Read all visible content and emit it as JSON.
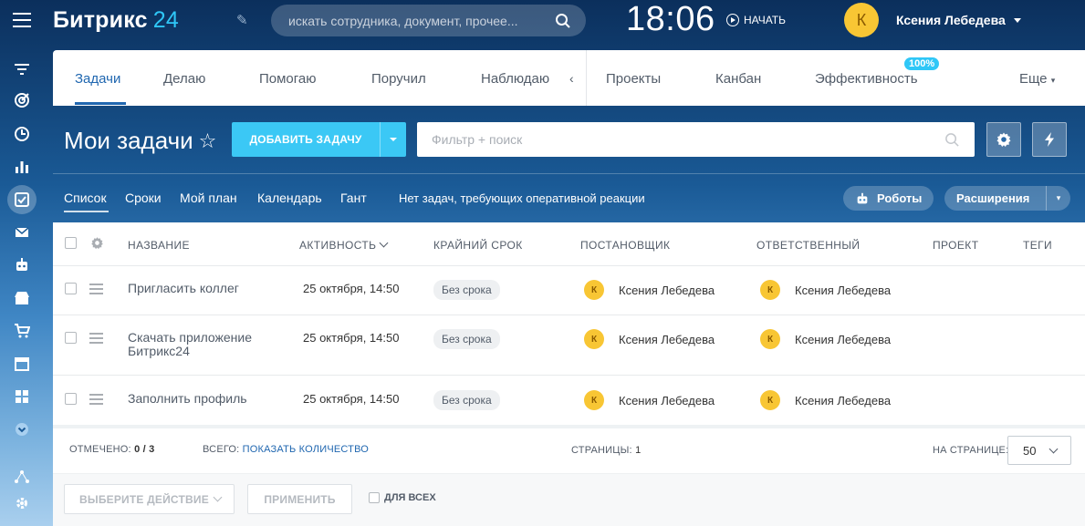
{
  "header": {
    "logo_text": "Битрикс",
    "logo_num": "24",
    "search_placeholder": "искать сотрудника, документ, прочее...",
    "clock": "18:06",
    "start_label": "НАЧАТЬ",
    "user_initial": "К",
    "user_name": "Ксения Лебедева"
  },
  "tabs": [
    {
      "label": "Задачи",
      "active": true
    },
    {
      "label": "Делаю"
    },
    {
      "label": "Помогаю"
    },
    {
      "label": "Поручил"
    },
    {
      "label": "Наблюдаю"
    },
    {
      "label": "Проекты"
    },
    {
      "label": "Канбан"
    },
    {
      "label": "Эффективность",
      "badge": "100%"
    },
    {
      "label": "Еще"
    }
  ],
  "page": {
    "title": "Мои задачи",
    "add_task_label": "ДОБАВИТЬ ЗАДАЧУ",
    "filter_placeholder": "Фильтр + поиск"
  },
  "views": {
    "items": [
      "Список",
      "Сроки",
      "Мой план",
      "Календарь",
      "Гант"
    ],
    "notice": "Нет задач, требующих оперативной реакции",
    "robots_label": "Роботы",
    "extensions_label": "Расширения"
  },
  "grid": {
    "columns": [
      "НАЗВАНИЕ",
      "АКТИВНОСТЬ",
      "КРАЙНИЙ СРОК",
      "ПОСТАНОВЩИК",
      "ОТВЕТСТВЕННЫЙ",
      "ПРОЕКТ",
      "ТЕГИ"
    ],
    "rows": [
      {
        "name": "Пригласить коллег",
        "activity": "25 октября, 14:50",
        "deadline": "Без срока",
        "creator_initial": "К",
        "creator": "Ксения Лебедева",
        "responsible_initial": "К",
        "responsible": "Ксения Лебедева"
      },
      {
        "name": "Скачать приложение Битрикс24",
        "activity": "25 октября, 14:50",
        "deadline": "Без срока",
        "creator_initial": "К",
        "creator": "Ксения Лебедева",
        "responsible_initial": "К",
        "responsible": "Ксения Лебедева"
      },
      {
        "name": "Заполнить профиль",
        "activity": "25 октября, 14:50",
        "deadline": "Без срока",
        "creator_initial": "К",
        "creator": "Ксения Лебедева",
        "responsible_initial": "К",
        "responsible": "Ксения Лебедева"
      }
    ]
  },
  "footer": {
    "checked_label": "ОТМЕЧЕНО:",
    "checked_value": "0 / 3",
    "total_label": "ВСЕГО:",
    "total_link": "ПОКАЗАТЬ КОЛИЧЕСТВО",
    "pages_label": "СТРАНИЦЫ:",
    "pages_value": "1",
    "per_page_label": "НА СТРАНИЦЕ:",
    "per_page_value": "50",
    "action_select": "ВЫБЕРИТЕ ДЕЙСТВИЕ",
    "apply_label": "ПРИМЕНИТЬ",
    "for_all_label": "ДЛЯ ВСЕХ"
  },
  "colors": {
    "accent": "#2067b0",
    "add_button": "#3bc8f5",
    "avatar": "#f8c634"
  }
}
